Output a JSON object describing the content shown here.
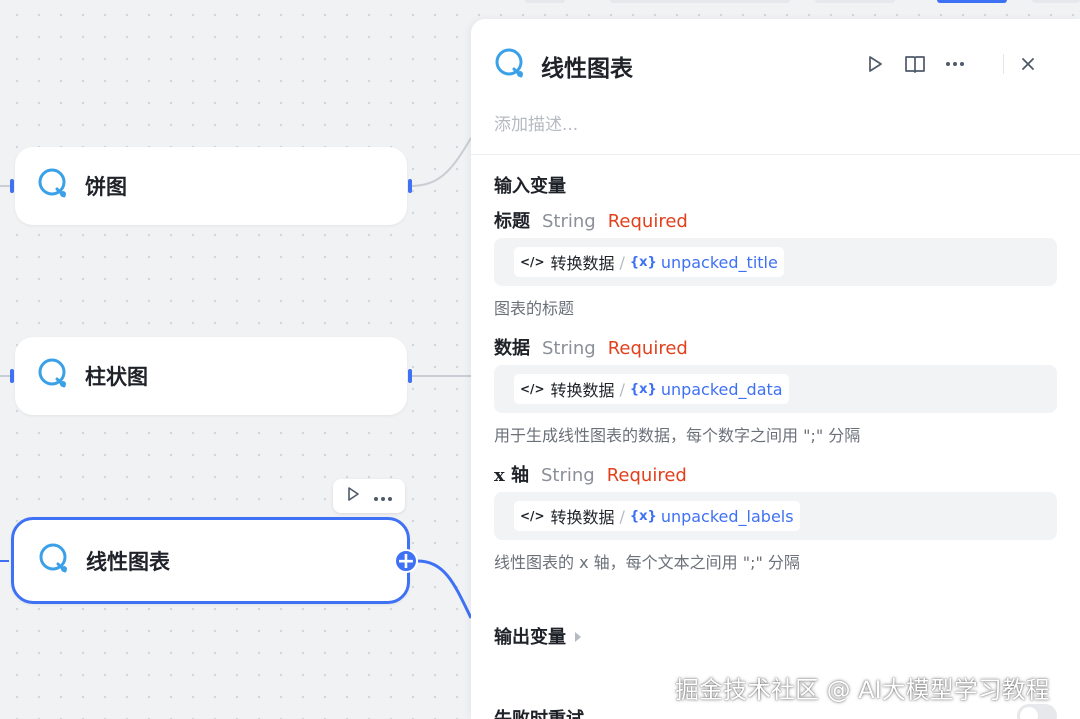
{
  "canvas": {
    "nodes": [
      {
        "label": "饼图",
        "icon": "chart-node-icon"
      },
      {
        "label": "柱状图",
        "icon": "chart-node-icon"
      },
      {
        "label": "线性图表",
        "icon": "chart-node-icon",
        "selected": true
      }
    ],
    "node_toolbar": {
      "run_icon": "play-icon",
      "more_icon": "more-icon"
    },
    "add_port_symbol": "+"
  },
  "panel": {
    "title": "线性图表",
    "description_placeholder": "添加描述...",
    "header_icons": [
      "play-icon",
      "book-icon",
      "more-icon",
      "close-icon"
    ],
    "input_section_title": "输入变量",
    "inputs": [
      {
        "name": "标题",
        "type": "String",
        "required": "Required",
        "source": "转换数据",
        "variable": "unpacked_title",
        "desc": "图表的标题"
      },
      {
        "name": "数据",
        "type": "String",
        "required": "Required",
        "source": "转换数据",
        "variable": "unpacked_data",
        "desc": "用于生成线性图表的数据，每个数字之间用 \";\" 分隔"
      },
      {
        "name": "x 轴",
        "type": "String",
        "required": "Required",
        "source": "转换数据",
        "variable": "unpacked_labels",
        "desc": "线性图表的 x 轴，每个文本之间用 \";\" 分隔"
      }
    ],
    "variable_icon_text": "{x}",
    "source_icon_text": "</>",
    "output_section_title": "输出变量",
    "retry_section_title": "失败时重试",
    "accent_color": "#3f71f5",
    "required_color": "#e2401c"
  },
  "watermark": "掘金技术社区 @ AI大模型学习教程"
}
